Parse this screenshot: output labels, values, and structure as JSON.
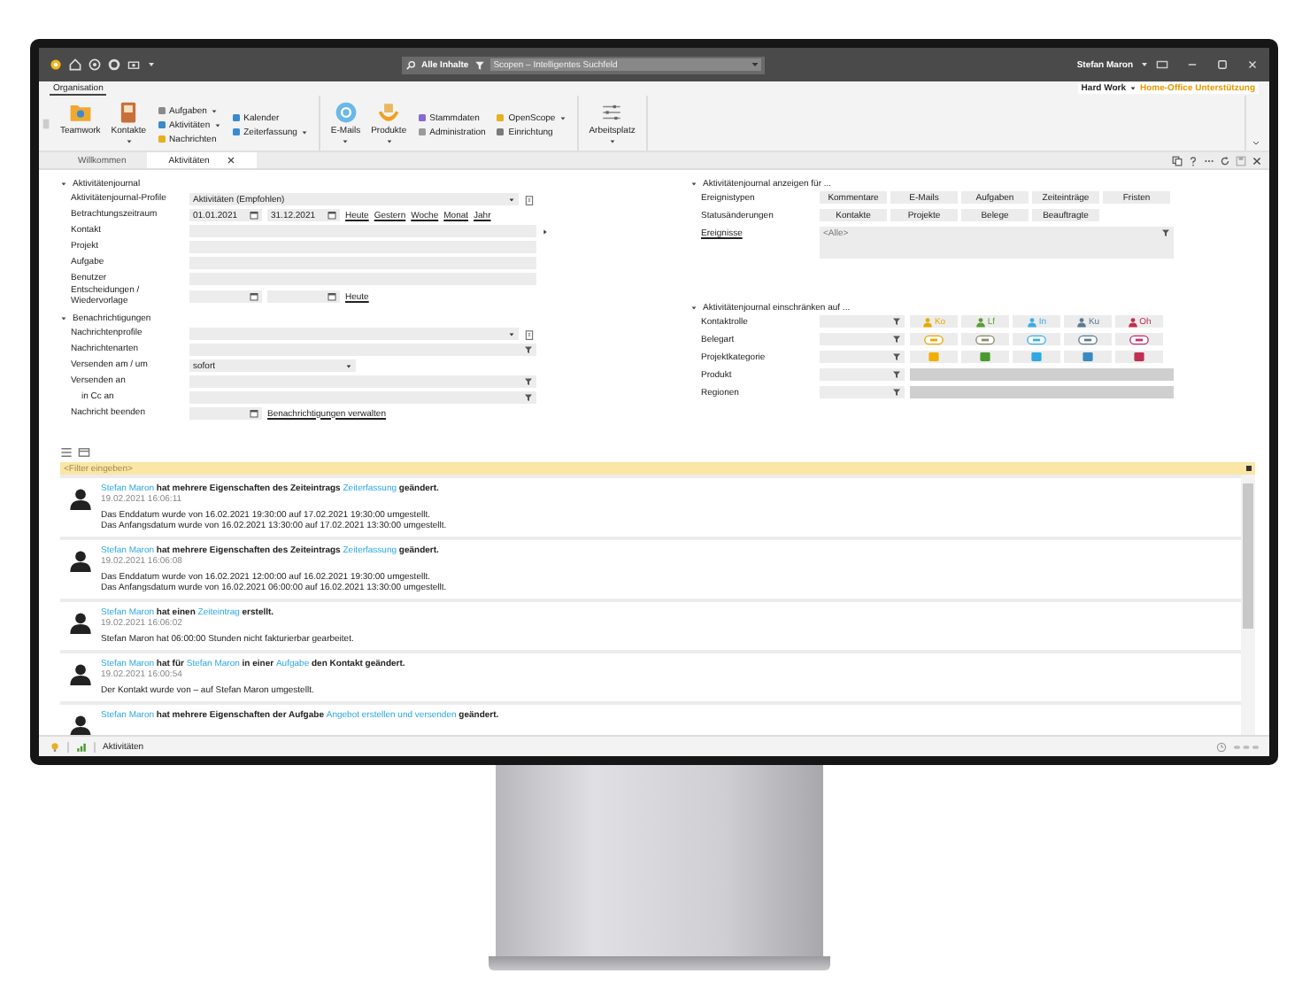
{
  "titlebar": {
    "scope": "Alle Inhalte",
    "search_placeholder": "Scopen – Intelligentes Suchfeld",
    "user": "Stefan Maron"
  },
  "ribbon": {
    "tabs": [
      {
        "label": "Organisation",
        "selected": true
      }
    ],
    "context": "Hard Work",
    "context_value": "Home-Office Unterstützung",
    "groups": [
      {
        "columns": [
          [
            {
              "kind": "large",
              "label": "Teamwork",
              "dropdown": false
            }
          ],
          [
            {
              "kind": "large",
              "label": "Kontakte",
              "dropdown": true
            }
          ],
          [
            {
              "kind": "small",
              "label": "Aufgaben",
              "dropdown": true
            },
            {
              "kind": "small",
              "label": "Aktivitäten",
              "dropdown": true
            },
            {
              "kind": "small",
              "label": "Nachrichten",
              "dropdown": false
            }
          ],
          [
            {
              "kind": "small",
              "label": "Kalender",
              "dropdown": false
            },
            {
              "kind": "small",
              "label": "Zeiterfassung",
              "dropdown": true
            }
          ]
        ]
      },
      {
        "columns": [
          [
            {
              "kind": "large",
              "label": "E-Mails",
              "dropdown": true
            }
          ],
          [
            {
              "kind": "large",
              "label": "Produkte",
              "dropdown": true
            }
          ],
          [
            {
              "kind": "small",
              "label": "Stammdaten",
              "dropdown": false
            },
            {
              "kind": "small",
              "label": "Administration",
              "dropdown": false
            }
          ],
          [
            {
              "kind": "small",
              "label": "OpenScope",
              "dropdown": true
            },
            {
              "kind": "small",
              "label": "Einrichtung",
              "dropdown": false
            }
          ]
        ]
      },
      {
        "columns": [
          [
            {
              "kind": "large",
              "label": "Arbeitsplatz",
              "dropdown": true
            }
          ]
        ]
      }
    ]
  },
  "doc_tabs": [
    {
      "label": "Willkommen",
      "selected": false,
      "closable": false
    },
    {
      "label": "Aktivitäten",
      "selected": true,
      "closable": true
    }
  ],
  "left_sections": [
    {
      "title": "Aktivitätenjournal",
      "expanded": true,
      "rows": [
        {
          "kind": "select",
          "label": "Aktivitätenjournal-Profile",
          "value": "Aktivitäten (Empfohlen)"
        },
        {
          "kind": "daterange",
          "label": "Betrachtungszeitraum",
          "from": "01.01.2021",
          "to": "31.12.2021",
          "links": [
            "Heute",
            "Gestern",
            "Woche",
            "Monat",
            "Jahr"
          ]
        },
        {
          "kind": "text",
          "label": "Kontakt",
          "more": true
        },
        {
          "kind": "text",
          "label": "Projekt",
          "more": false
        },
        {
          "kind": "text",
          "label": "Aufgabe",
          "more": false
        },
        {
          "kind": "text",
          "label": "Benutzer",
          "more": false
        },
        {
          "kind": "daterange",
          "label": "Entscheidungen / Wiedervorlage",
          "links": [
            "Heute"
          ]
        }
      ]
    },
    {
      "title": "Benachrichtigungen",
      "expanded": true,
      "rows": [
        {
          "kind": "select",
          "label": "Nachrichtenprofile"
        },
        {
          "kind": "filter",
          "label": "Nachrichtenarten"
        },
        {
          "kind": "short-select",
          "label": "Versenden am / um",
          "value": "sofort"
        },
        {
          "kind": "filter",
          "label": "Versenden an",
          "children": [
            {
              "kind": "filter",
              "label": "in Cc an"
            }
          ]
        },
        {
          "kind": "date",
          "label": "Nachricht beenden",
          "links": [
            "Benachrichtigungen verwalten"
          ]
        }
      ]
    }
  ],
  "right_sections": [
    {
      "title": "Aktivitätenjournal anzeigen für ...",
      "expanded": true,
      "rows": [
        {
          "kind": "toggles",
          "label": "Ereignistypen",
          "items": [
            "Kommentare",
            "E-Mails",
            "Aufgaben",
            "Zeiteinträge",
            "Fristen"
          ]
        },
        {
          "kind": "toggles",
          "label": "Statusänderungen",
          "items": [
            "Kontakte",
            "Projekte",
            "Belege",
            "Beauftragte"
          ]
        },
        {
          "kind": "area",
          "label": "Ereignisse",
          "placeholder": "<Alle>"
        }
      ]
    },
    {
      "title": "Aktivitätenjournal einschränken auf ...",
      "expanded": true,
      "rows": [
        {
          "kind": "roles",
          "label": "Kontaktrolle",
          "chips": [
            {
              "label": "Ko",
              "color": "#e8a800"
            },
            {
              "label": "Lf",
              "color": "#5a9e3a"
            },
            {
              "label": "In",
              "color": "#3aaee0"
            },
            {
              "label": "Ku",
              "color": "#5a7a90"
            },
            {
              "label": "Oh",
              "color": "#c03050"
            }
          ]
        },
        {
          "kind": "doctypes",
          "label": "Belegart",
          "chips": [
            {
              "color": "#e8a800"
            },
            {
              "color": "#8a8a6a"
            },
            {
              "color": "#3aaee0"
            },
            {
              "color": "#5a7a90"
            },
            {
              "color": "#c03070"
            }
          ]
        },
        {
          "kind": "categories",
          "label": "Projektkategorie",
          "chips": [
            {
              "color": "#f0b000"
            },
            {
              "color": "#4a9a30"
            },
            {
              "color": "#30a8e0"
            },
            {
              "color": "#3a8ac0"
            },
            {
              "color": "#c03050"
            }
          ]
        },
        {
          "kind": "bar",
          "label": "Produkt"
        },
        {
          "kind": "bar",
          "label": "Regionen"
        }
      ]
    }
  ],
  "feed": {
    "filter_placeholder": "<Filter eingeben>",
    "entries": [
      {
        "headline": [
          {
            "text": "Stefan Maron",
            "link": true
          },
          {
            "text": " hat mehrere Eigenschaften des Zeiteintrags ",
            "link": false
          },
          {
            "text": "Zeiterfassung",
            "link": true
          },
          {
            "text": " geändert.",
            "link": false
          }
        ],
        "time": "19.02.2021 16:06:11",
        "details": [
          "Das Enddatum wurde von 16.02.2021 19:30:00 auf 17.02.2021 19:30:00 umgestellt.",
          "Das Anfangsdatum wurde von 16.02.2021 13:30:00 auf 17.02.2021 13:30:00 umgestellt."
        ]
      },
      {
        "headline": [
          {
            "text": "Stefan Maron",
            "link": true
          },
          {
            "text": " hat mehrere Eigenschaften des Zeiteintrags ",
            "link": false
          },
          {
            "text": "Zeiterfassung",
            "link": true
          },
          {
            "text": " geändert.",
            "link": false
          }
        ],
        "time": "19.02.2021 16:06:08",
        "details": [
          "Das Enddatum wurde von 16.02.2021 12:00:00 auf 16.02.2021 19:30:00 umgestellt.",
          "Das Anfangsdatum wurde von 16.02.2021 06:00:00 auf 16.02.2021 13:30:00 umgestellt."
        ]
      },
      {
        "headline": [
          {
            "text": "Stefan Maron",
            "link": true
          },
          {
            "text": " hat einen ",
            "link": false
          },
          {
            "text": "Zeiteintrag",
            "link": true
          },
          {
            "text": " erstellt.",
            "link": false
          }
        ],
        "time": "19.02.2021 16:06:02",
        "details": [
          "Stefan Maron hat 06:00:00 Stunden nicht fakturierbar gearbeitet."
        ]
      },
      {
        "headline": [
          {
            "text": "Stefan Maron",
            "link": true
          },
          {
            "text": " hat für ",
            "link": false
          },
          {
            "text": "Stefan Maron",
            "link": true
          },
          {
            "text": " in einer ",
            "link": false
          },
          {
            "text": "Aufgabe",
            "link": true
          },
          {
            "text": " den Kontakt geändert.",
            "link": false
          }
        ],
        "time": "19.02.2021 16:00:54",
        "details": [
          "Der Kontakt wurde von – auf Stefan Maron umgestellt."
        ]
      },
      {
        "headline": [
          {
            "text": "Stefan Maron",
            "link": true
          },
          {
            "text": " hat mehrere Eigenschaften der Aufgabe ",
            "link": false
          },
          {
            "text": "Angebot erstellen und versenden",
            "link": true
          },
          {
            "text": " geändert.",
            "link": false
          }
        ]
      }
    ]
  },
  "status_bar": {
    "label": "Aktivitäten"
  }
}
